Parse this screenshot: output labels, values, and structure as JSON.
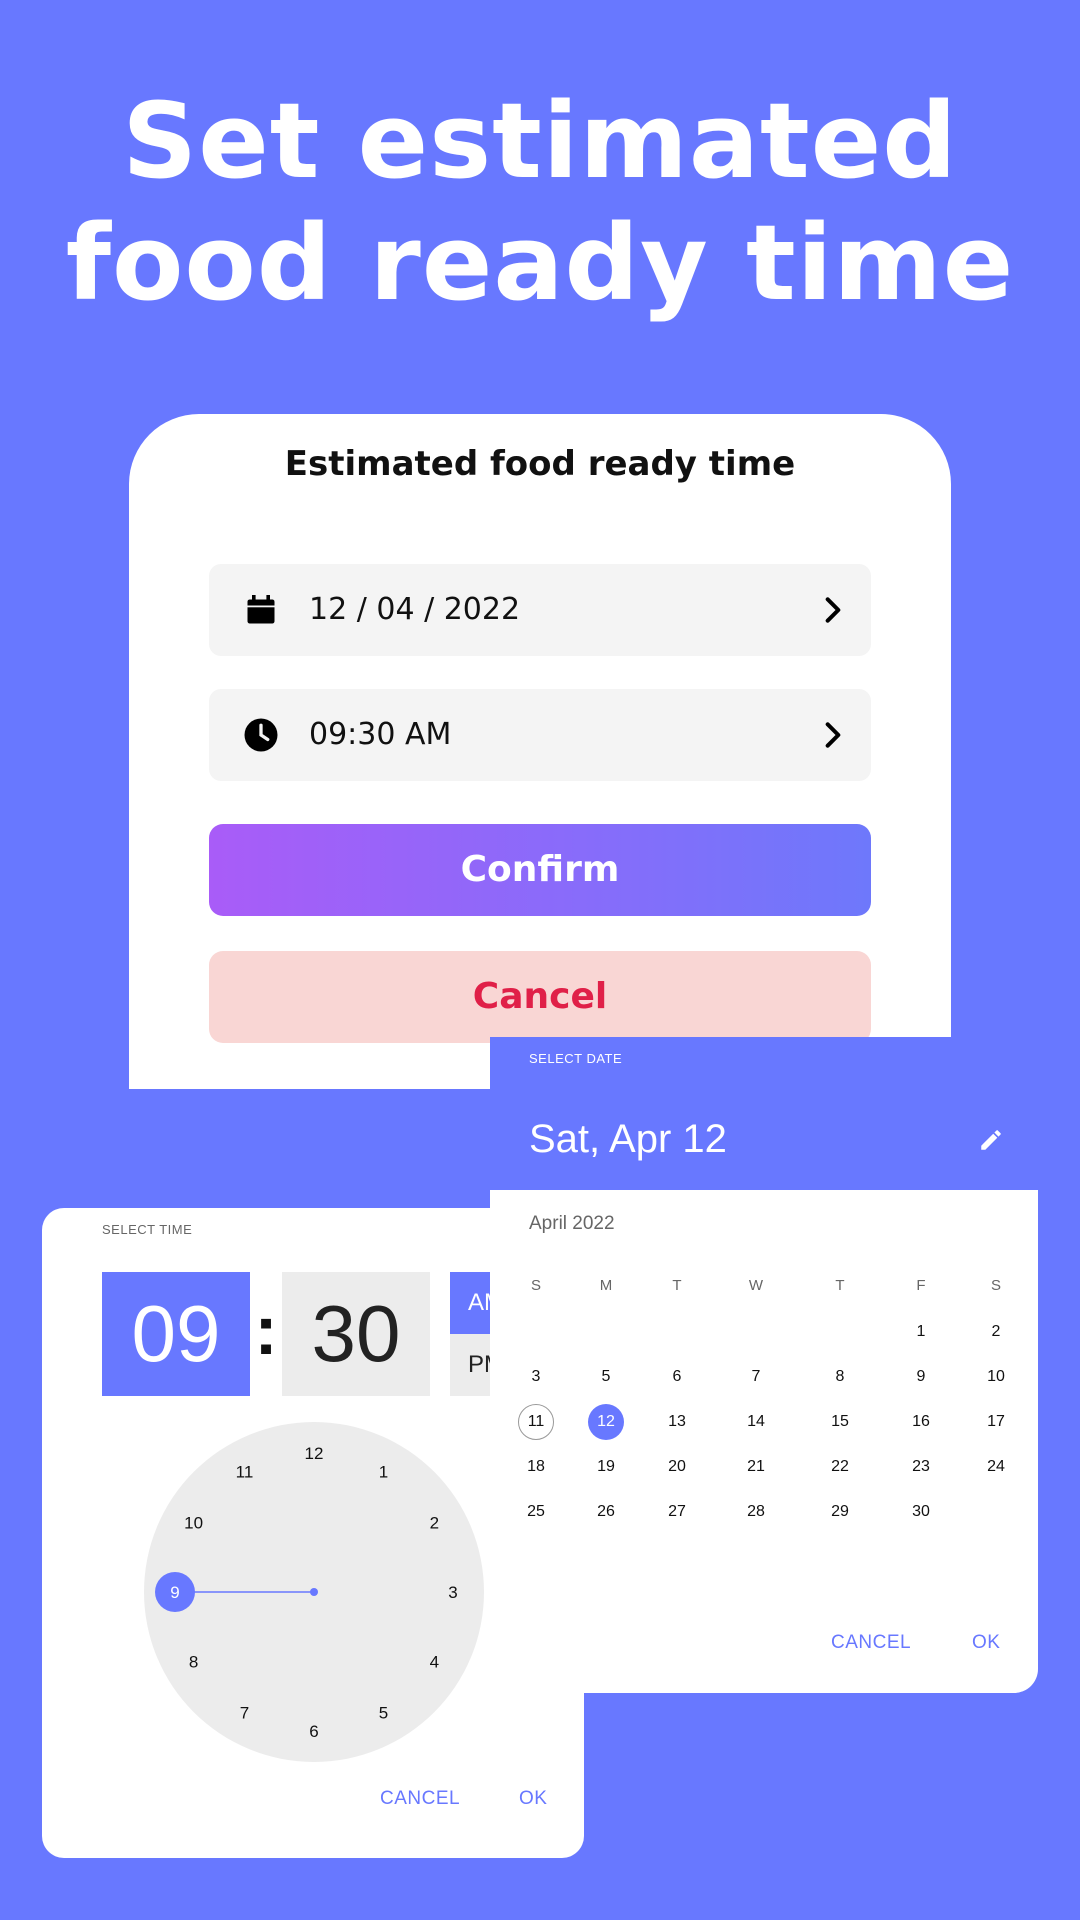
{
  "headline": {
    "line1": "Set estimated",
    "line2": "food ready time"
  },
  "card": {
    "title": "Estimated food ready time",
    "date_value": "12 / 04 / 2022",
    "time_value": "09:30 AM",
    "confirm_label": "Confirm",
    "cancel_label": "Cancel"
  },
  "time_picker": {
    "label": "SELECT TIME",
    "hour": "09",
    "colon": ":",
    "minute": "30",
    "am": "AM",
    "pm": "PM",
    "clock_numbers": [
      "12",
      "1",
      "2",
      "3",
      "4",
      "5",
      "6",
      "7",
      "8",
      "9",
      "10",
      "11"
    ],
    "selected_hour": "9",
    "cancel_label": "CANCEL",
    "ok_label": "OK"
  },
  "date_picker": {
    "label": "SELECT DATE",
    "selected_text": "Sat, Apr 12",
    "month_label": "April 2022",
    "weekdays": [
      "S",
      "M",
      "T",
      "W",
      "T",
      "F",
      "S"
    ],
    "weeks": [
      [
        "",
        "",
        "",
        "",
        "",
        "1",
        "2"
      ],
      [
        "3",
        "5",
        "6",
        "7",
        "8",
        "9",
        "10"
      ],
      [
        "11",
        "12",
        "13",
        "14",
        "15",
        "16",
        "17"
      ],
      [
        "18",
        "19",
        "20",
        "21",
        "22",
        "23",
        "24"
      ],
      [
        "25",
        "26",
        "27",
        "28",
        "29",
        "30",
        ""
      ]
    ],
    "today": "11",
    "selected_day": "12",
    "cancel_label": "CANCEL",
    "ok_label": "OK"
  },
  "colors": {
    "background": "#6878FF",
    "accent": "#6878FF",
    "confirm_gradient_start": "#A95CF8",
    "confirm_gradient_end": "#6E78FB",
    "cancel_text": "#E02048",
    "cancel_bg": "#F9D6D4"
  },
  "icons": {
    "date": "calendar-icon",
    "time": "clock-icon",
    "chevron": "chevron-right-icon",
    "edit": "pencil-icon"
  }
}
